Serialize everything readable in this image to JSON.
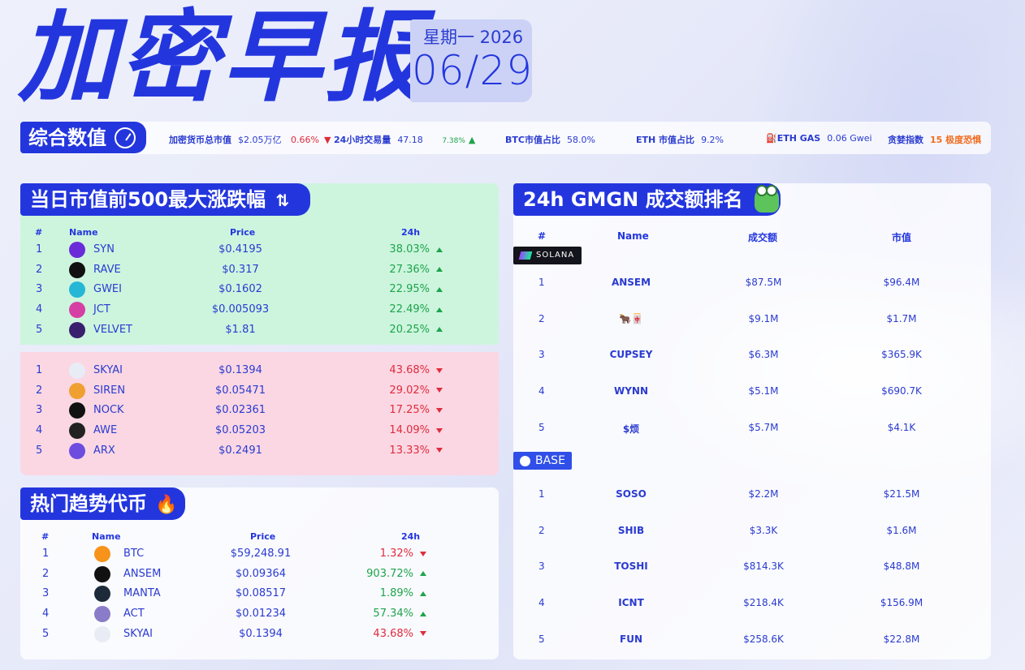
{
  "header": {
    "title": "加密早报",
    "weekday": "星期一 2026",
    "date": "06/29"
  },
  "stats": {
    "label": "综合数值",
    "market_cap_label": "加密货币总市值",
    "market_cap_value": "$2.05万亿",
    "market_cap_change": "0.66%",
    "volume_label": "24小时交易量",
    "volume_value": "47.18",
    "volume_change": "7.38%",
    "btc_dom_label": "BTC市值占比",
    "btc_dom_value": "58.0%",
    "eth_dom_label": "ETH 市值占比",
    "eth_dom_value": "9.2%",
    "gas_label": "ETH GAS",
    "gas_value": "0.06 Gwei",
    "fear_label": "贪婪指数",
    "fear_value": "15 极度恐惧"
  },
  "movers": {
    "title": "当日市值前500最大涨跌幅",
    "headers": {
      "rank": "#",
      "name": "Name",
      "price": "Price",
      "change": "24h"
    },
    "gainers": [
      {
        "rank": "1",
        "name": "SYN",
        "price": "$0.4195",
        "change": "38.03%",
        "icon_color": "#6a2bd9"
      },
      {
        "rank": "2",
        "name": "RAVE",
        "price": "$0.317",
        "change": "27.36%",
        "icon_color": "#111111"
      },
      {
        "rank": "3",
        "name": "GWEI",
        "price": "$0.1602",
        "change": "22.95%",
        "icon_color": "#26b6d6"
      },
      {
        "rank": "4",
        "name": "JCT",
        "price": "$0.005093",
        "change": "22.49%",
        "icon_color": "#d63fa4"
      },
      {
        "rank": "5",
        "name": "VELVET",
        "price": "$1.81",
        "change": "20.25%",
        "icon_color": "#3a1f6e"
      }
    ],
    "losers": [
      {
        "rank": "1",
        "name": "SKYAI",
        "price": "$0.1394",
        "change": "43.68%",
        "icon_color": "#e8edf5"
      },
      {
        "rank": "2",
        "name": "SIREN",
        "price": "$0.05471",
        "change": "29.02%",
        "icon_color": "#f0a030"
      },
      {
        "rank": "3",
        "name": "NOCK",
        "price": "$0.02361",
        "change": "17.25%",
        "icon_color": "#111111"
      },
      {
        "rank": "4",
        "name": "AWE",
        "price": "$0.05203",
        "change": "14.09%",
        "icon_color": "#222222"
      },
      {
        "rank": "5",
        "name": "ARX",
        "price": "$0.2491",
        "change": "13.33%",
        "icon_color": "#6d4ce0"
      }
    ]
  },
  "trending": {
    "title": "热门趋势代币",
    "headers": {
      "rank": "#",
      "name": "Name",
      "price": "Price",
      "change": "24h"
    },
    "rows": [
      {
        "rank": "1",
        "name": "BTC",
        "price": "$59,248.91",
        "change": "1.32%",
        "dir": "down",
        "icon_color": "#f7931a"
      },
      {
        "rank": "2",
        "name": "ANSEM",
        "price": "$0.09364",
        "change": "903.72%",
        "dir": "up",
        "icon_color": "#111111"
      },
      {
        "rank": "3",
        "name": "MANTA",
        "price": "$0.08517",
        "change": "1.89%",
        "dir": "up",
        "icon_color": "#1c2a3a"
      },
      {
        "rank": "4",
        "name": "ACT",
        "price": "$0.01234",
        "change": "57.34%",
        "dir": "up",
        "icon_color": "#8a7cc8"
      },
      {
        "rank": "5",
        "name": "SKYAI",
        "price": "$0.1394",
        "change": "43.68%",
        "dir": "down",
        "icon_color": "#e8edf5"
      }
    ]
  },
  "gmgn": {
    "title": "24h GMGN 成交额排名",
    "headers": {
      "rank": "#",
      "name": "Name",
      "volume": "成交额",
      "mcap": "市值"
    },
    "solana_label": "SOLANA",
    "base_label": "BASE",
    "solana": [
      {
        "rank": "1",
        "name": "ANSEM",
        "volume": "$87.5M",
        "mcap": "$96.4M"
      },
      {
        "rank": "2",
        "name": "🐂🀄",
        "volume": "$9.1M",
        "mcap": "$1.7M"
      },
      {
        "rank": "3",
        "name": "CUPSEY",
        "volume": "$6.3M",
        "mcap": "$365.9K"
      },
      {
        "rank": "4",
        "name": "WYNN",
        "volume": "$5.1M",
        "mcap": "$690.7K"
      },
      {
        "rank": "5",
        "name": "$烦",
        "volume": "$5.7M",
        "mcap": "$4.1K"
      }
    ],
    "base": [
      {
        "rank": "1",
        "name": "SOSO",
        "volume": "$2.2M",
        "mcap": "$21.5M"
      },
      {
        "rank": "2",
        "name": "SHIB",
        "volume": "$3.3K",
        "mcap": "$1.6M"
      },
      {
        "rank": "3",
        "name": "TOSHI",
        "volume": "$814.3K",
        "mcap": "$48.8M"
      },
      {
        "rank": "4",
        "name": "ICNT",
        "volume": "$218.4K",
        "mcap": "$156.9M"
      },
      {
        "rank": "5",
        "name": "FUN",
        "volume": "$258.6K",
        "mcap": "$22.8M"
      }
    ]
  },
  "colors": {
    "brand": "#2336de",
    "up": "#1ea44a",
    "down": "#e02b3c",
    "fear": "#f26b1d"
  }
}
